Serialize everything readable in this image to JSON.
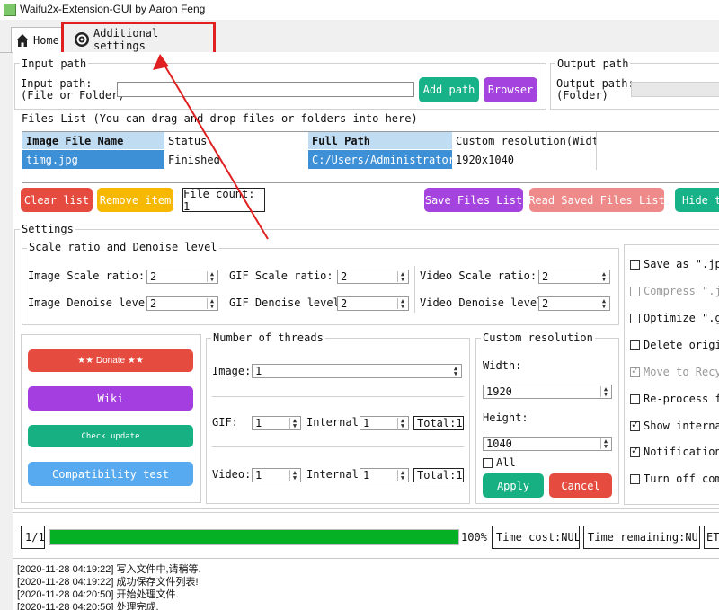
{
  "window": {
    "title": "Waifu2x-Extension-GUI by Aaron Feng"
  },
  "tabs": [
    {
      "label": "Home",
      "icon": "home-icon"
    },
    {
      "label": "Additional settings",
      "icon": "gear-icon"
    }
  ],
  "annotation": {
    "color": "#e02020"
  },
  "input_path": {
    "group_title": "Input path",
    "label_line1": "Input path:",
    "label_line2": "(File or Folder)",
    "value": "",
    "add_path": "Add path",
    "browser": "Browser"
  },
  "output_path": {
    "group_title": "Output path",
    "label_line1": "Output path:",
    "label_line2": "(Folder)"
  },
  "files_list": {
    "title": "Files List (You can drag and drop files or folders into here)",
    "headers": [
      "Image File Name",
      "Status",
      "Full Path",
      "Custom resolution(Width"
    ],
    "rows": [
      [
        "timg.jpg",
        "Finished",
        "C:/Users/Administrator…",
        "1920x1040"
      ]
    ],
    "clear_list": "Clear list",
    "remove_item": "Remove item",
    "file_count": "File count: 1",
    "save_files_list": "Save Files List",
    "read_saved_files_list": "Read Saved Files List",
    "hide": "Hide t"
  },
  "settings": {
    "title": "Settings",
    "scale_group_title": "Scale ratio and Denoise level",
    "image_scale_label": "Image Scale ratio:",
    "image_scale_value": "2",
    "gif_scale_label": "GIF Scale ratio:",
    "gif_scale_value": "2",
    "video_scale_label": "Video Scale ratio:",
    "video_scale_value": "2",
    "image_denoise_label": "Image Denoise level:",
    "image_denoise_value": "2",
    "gif_denoise_label": "GIF Denoise level:",
    "gif_denoise_value": "2",
    "video_denoise_label": "Video Denoise level:",
    "video_denoise_value": "2"
  },
  "options": [
    {
      "label": "Save as \".jpg",
      "checked": false,
      "disabled": false
    },
    {
      "label": "Compress \".jp",
      "checked": false,
      "disabled": true
    },
    {
      "label": "Optimize \".gi",
      "checked": false,
      "disabled": false
    },
    {
      "label": "Delete origin",
      "checked": false,
      "disabled": false
    },
    {
      "label": "Move to Recyc",
      "checked": true,
      "disabled": true
    },
    {
      "label": "Re-process fi",
      "checked": false,
      "disabled": false
    },
    {
      "label": "Show internal",
      "checked": true,
      "disabled": false
    },
    {
      "label": "Notification",
      "checked": true,
      "disabled": false
    },
    {
      "label": "Turn off comp",
      "checked": false,
      "disabled": false
    }
  ],
  "left_buttons": {
    "donate": "★★ Donate ★★",
    "wiki": "Wiki",
    "check_update": "Check update",
    "compatibility_test": "Compatibility test",
    "colors": {
      "donate": "#e54b3f",
      "wiki": "#a43ee0",
      "check_update": "#16b083",
      "compatibility": "#57aaf0"
    }
  },
  "threads": {
    "title": "Number of threads",
    "image_label": "Image:",
    "image_value": "1",
    "gif_label": "GIF:",
    "gif_value": "1",
    "gif_internal_label": "Internal:",
    "gif_internal_value": "1",
    "gif_total": "Total:1",
    "video_label": "Video:",
    "video_value": "1",
    "video_internal_label": "Internal:",
    "video_internal_value": "1",
    "video_total": "Total:1"
  },
  "custom_resolution": {
    "title": "Custom resolution",
    "width_label": "Width:",
    "width_value": "1920",
    "height_label": "Height:",
    "height_value": "1040",
    "all_label": "All",
    "apply": "Apply",
    "cancel": "Cancel"
  },
  "progress": {
    "count": "1/1",
    "percent_label": "100%",
    "percent": 1.0,
    "bar_color": "#06b025",
    "time_cost": "Time cost:NULL",
    "time_remaining": "Time remaining:NULL",
    "etc": "ET"
  },
  "log": [
    "[2020-11-28 04:19:22] 写入文件中,请稍等.",
    "[2020-11-28 04:19:22] 成功保存文件列表!",
    "[2020-11-28 04:20:50] 开始处理文件.",
    "[2020-11-28 04:20:56] 处理完成."
  ]
}
